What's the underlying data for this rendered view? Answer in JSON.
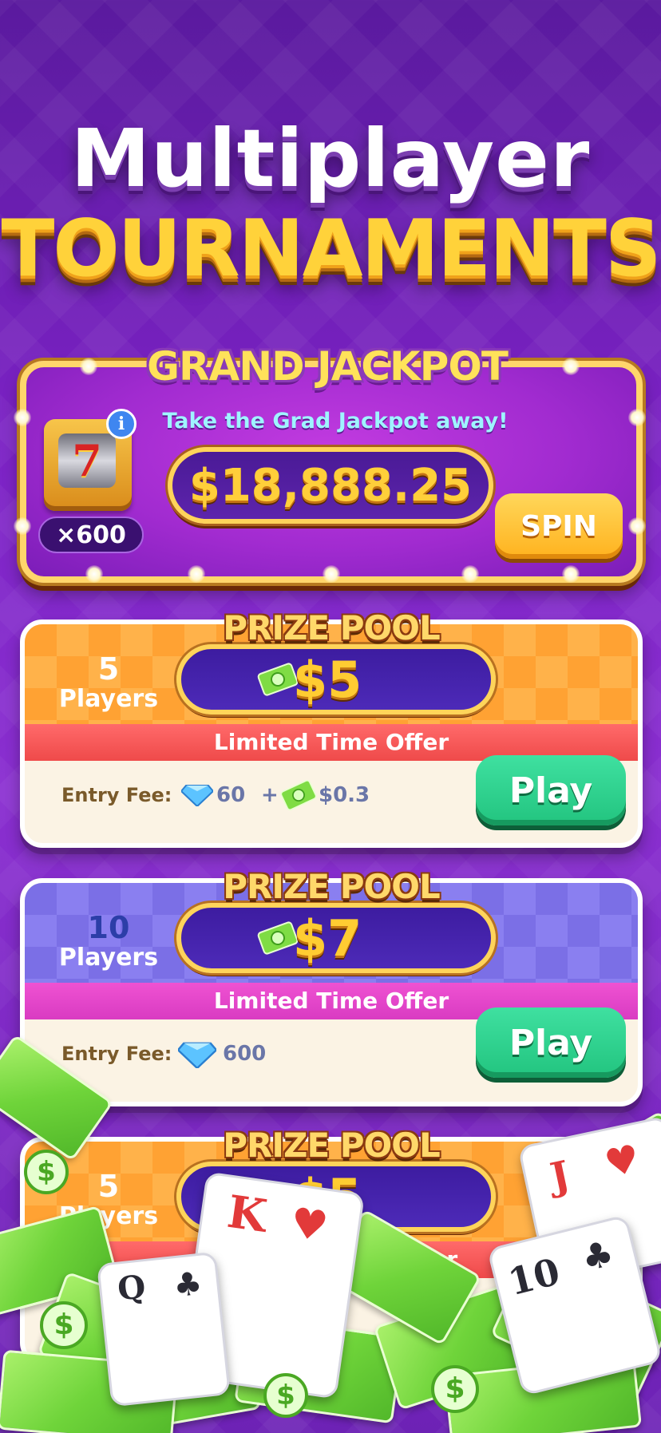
{
  "headline": {
    "line1": "Multiplayer",
    "line2": "TOURNAMENTS"
  },
  "jackpot": {
    "title": "GRAND JACKPOT",
    "subtitle": "Take the Grad Jackpot away!",
    "amount": "$18,888.25",
    "multiplier": "×600",
    "slot_symbol": "7",
    "info_glyph": "i",
    "spin_label": "SPIN"
  },
  "cards": [
    {
      "players_count": "5",
      "players_label": "Players",
      "pool_title": "PRIZE POOL",
      "prize": "$5",
      "offer": "Limited Time Offer",
      "entry_label": "Entry Fee:",
      "gems": "60",
      "plus": "+",
      "cash": "$0.3",
      "play_label": "Play",
      "theme": "orange"
    },
    {
      "players_count": "10",
      "players_label": "Players",
      "pool_title": "PRIZE POOL",
      "prize": "$7",
      "offer": "Limited Time Offer",
      "entry_label": "Entry Fee:",
      "gems": "600",
      "play_label": "Play",
      "theme": "purple"
    },
    {
      "players_count": "5",
      "players_label": "Players",
      "pool_title": "PRIZE POOL",
      "prize": "$5",
      "offer_partial": "me Offer",
      "theme": "orange"
    }
  ],
  "playing_cards": [
    {
      "rank": "K",
      "suit": "♥"
    },
    {
      "rank": "Q",
      "suit": "♣"
    },
    {
      "rank": "J",
      "suit": "♥"
    },
    {
      "rank": "10",
      "suit": "♣"
    }
  ],
  "icons": {
    "cash": "cash-icon",
    "gem": "diamond-icon",
    "info": "info-icon",
    "slot": "slot-machine-icon"
  },
  "colors": {
    "background": "#7b22c4",
    "gold": "#ffd23a",
    "play_green": "#22c47f",
    "offer_red": "#ef4a4a",
    "offer_pink": "#d93bc2"
  }
}
